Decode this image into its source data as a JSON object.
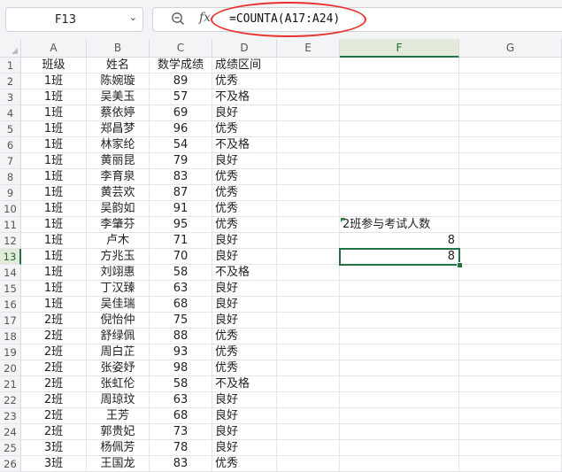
{
  "name_box": "F13",
  "formula": "=COUNTA(A17:A24)",
  "fx_label": "fx",
  "columns": [
    {
      "label": "A",
      "width": 0
    },
    {
      "label": "B"
    },
    {
      "label": "C"
    },
    {
      "label": "D"
    },
    {
      "label": "E"
    },
    {
      "label": "F"
    },
    {
      "label": "G"
    }
  ],
  "active_cell": {
    "column": "F",
    "row": "13"
  },
  "header_row": [
    "班级",
    "姓名",
    "数学成绩",
    "成绩区间"
  ],
  "data_rows": [
    [
      "1班",
      "陈婉璇",
      "89",
      "优秀"
    ],
    [
      "1班",
      "吴美玉",
      "57",
      "不及格"
    ],
    [
      "1班",
      "蔡依婷",
      "69",
      "良好"
    ],
    [
      "1班",
      "郑昌梦",
      "96",
      "优秀"
    ],
    [
      "1班",
      "林家纶",
      "54",
      "不及格"
    ],
    [
      "1班",
      "黄丽昆",
      "79",
      "良好"
    ],
    [
      "1班",
      "李育泉",
      "83",
      "优秀"
    ],
    [
      "1班",
      "黄芸欢",
      "87",
      "优秀"
    ],
    [
      "1班",
      "吴韵如",
      "91",
      "优秀"
    ],
    [
      "1班",
      "李肇芬",
      "95",
      "优秀"
    ],
    [
      "1班",
      "卢木",
      "71",
      "良好"
    ],
    [
      "1班",
      "方兆玉",
      "70",
      "良好"
    ],
    [
      "1班",
      "刘翊惠",
      "58",
      "不及格"
    ],
    [
      "1班",
      "丁汉臻",
      "63",
      "良好"
    ],
    [
      "1班",
      "吴佳瑞",
      "68",
      "良好"
    ],
    [
      "2班",
      "倪怡仲",
      "75",
      "良好"
    ],
    [
      "2班",
      "舒绿佩",
      "88",
      "优秀"
    ],
    [
      "2班",
      "周白芷",
      "93",
      "优秀"
    ],
    [
      "2班",
      "张姿妤",
      "98",
      "优秀"
    ],
    [
      "2班",
      "张虹伦",
      "58",
      "不及格"
    ],
    [
      "2班",
      "周琼玟",
      "63",
      "良好"
    ],
    [
      "2班",
      "王芳",
      "68",
      "良好"
    ],
    [
      "2班",
      "郭贵妃",
      "73",
      "良好"
    ],
    [
      "3班",
      "杨佩芳",
      "78",
      "良好"
    ],
    [
      "3班",
      "王国龙",
      "83",
      "优秀"
    ]
  ],
  "row_numbers": [
    "1",
    "2",
    "3",
    "4",
    "5",
    "6",
    "7",
    "8",
    "9",
    "10",
    "11",
    "12",
    "13",
    "14",
    "15",
    "16",
    "17",
    "18",
    "19",
    "20",
    "21",
    "22",
    "23",
    "24",
    "25",
    "26"
  ],
  "side_cells": {
    "F11_label": "2班参与考试人数",
    "F12_value": "8",
    "F13_value": "8"
  }
}
